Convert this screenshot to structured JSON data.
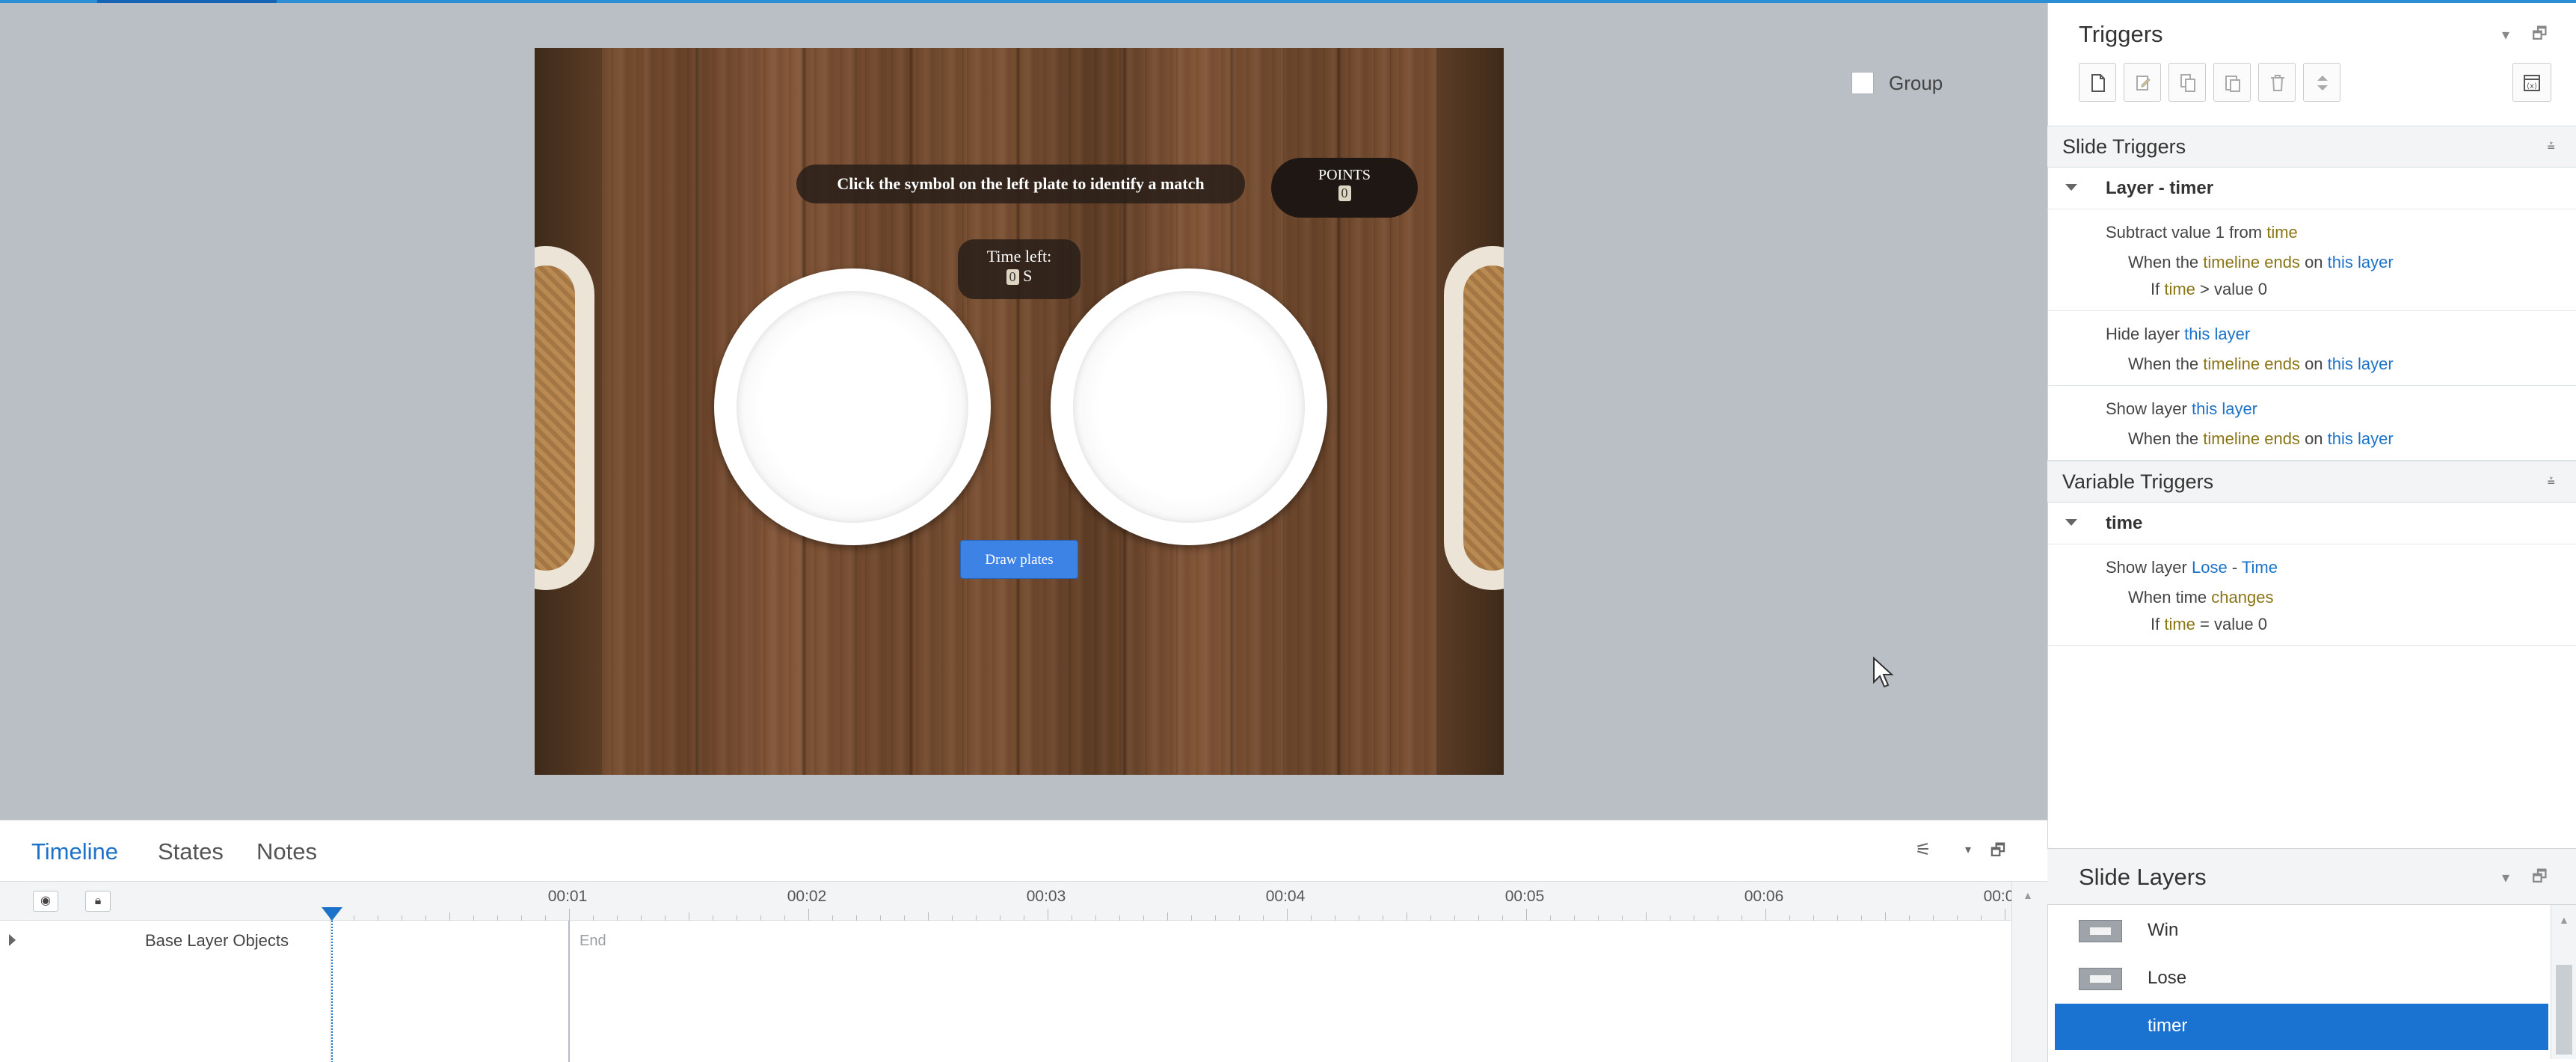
{
  "slide": {
    "instruction": "Click the symbol on the left plate to identify a match",
    "points_label": "POINTS",
    "points_value": "0",
    "time_left_label": "Time left:",
    "time_left_value": "0",
    "time_unit": "S",
    "draw_button": "Draw plates"
  },
  "bottom_tabs": [
    "Timeline",
    "States",
    "Notes"
  ],
  "timeline": {
    "ticks": [
      "00:01",
      "00:02",
      "00:03",
      "00:04",
      "00:05",
      "00:06",
      "00:0"
    ],
    "row_label": "Base Layer Objects",
    "end_label": "End"
  },
  "triggers": {
    "title": "Triggers",
    "group_label": "Group",
    "slide_triggers_title": "Slide Triggers",
    "layer_timer_title": "Layer - timer",
    "t1": {
      "action": "Subtract value 1 from",
      "target": "time",
      "when_pre": "When the",
      "when_event": "timeline ends",
      "when_on": "on",
      "when_obj": "this layer",
      "if_pre": "If",
      "if_var": "time",
      "if_rest": "> value 0"
    },
    "t2": {
      "action": "Hide layer",
      "target": "this layer",
      "when_pre": "When the",
      "when_event": "timeline ends",
      "when_on": "on",
      "when_obj": "this layer"
    },
    "t3": {
      "action": "Show layer",
      "target": "this layer",
      "when_pre": "When the",
      "when_event": "timeline ends",
      "when_on": "on",
      "when_obj": "this layer"
    },
    "variable_triggers_title": "Variable Triggers",
    "var_time_title": "time",
    "t4": {
      "action": "Show layer",
      "target_a": "Lose",
      "target_sep": "-",
      "target_b": "Time",
      "when_pre": "When time",
      "when_event": "changes",
      "if_pre": "If",
      "if_var": "time",
      "if_rest": "= value 0"
    }
  },
  "slide_layers": {
    "title": "Slide Layers",
    "items": [
      "Win",
      "Lose",
      "timer"
    ],
    "selected": "timer"
  }
}
